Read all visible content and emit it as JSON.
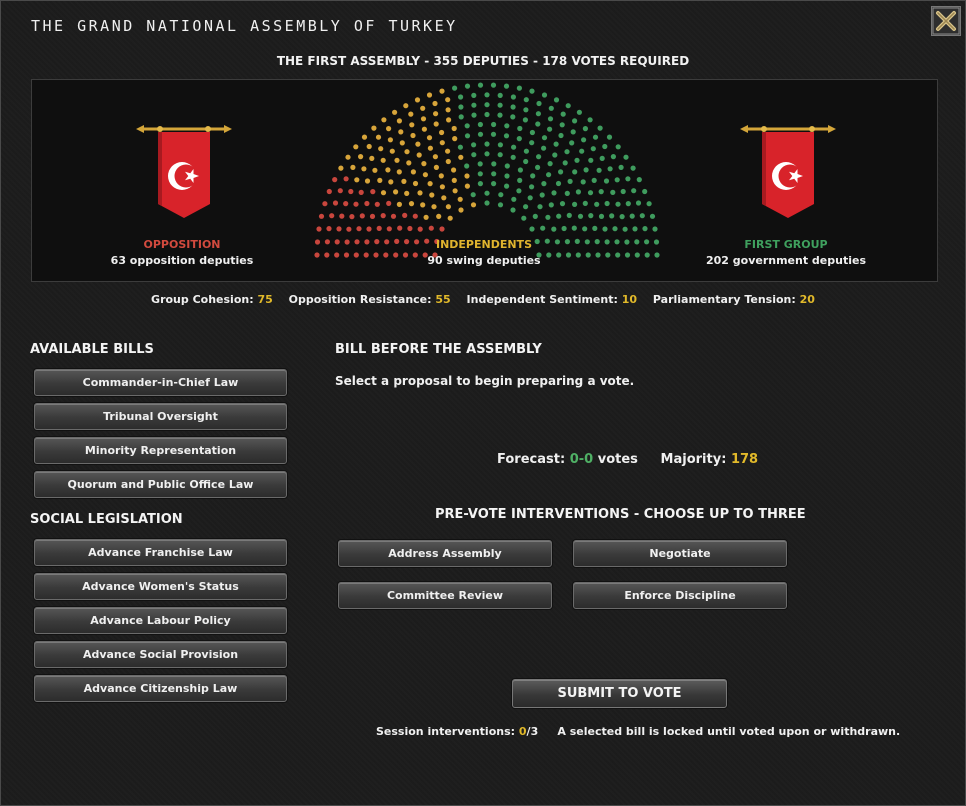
{
  "title": "THE GRAND NATIONAL ASSEMBLY OF TURKEY",
  "subtitle": "THE FIRST ASSEMBLY - 355 DEPUTIES - 178 VOTES REQUIRED",
  "colors": {
    "opposition": "#c9463d",
    "independents": "#d8a53a",
    "government": "#3f9c5e",
    "value": "#e1b92a",
    "banner": "#d8232a"
  },
  "factions": {
    "opposition": {
      "label": "OPPOSITION",
      "desc": "63 opposition deputies",
      "seats": 63
    },
    "independents": {
      "label": "INDEPENDENTS",
      "desc": "90 swing deputies",
      "seats": 90
    },
    "government": {
      "label": "FIRST GROUP",
      "desc": "202 government deputies",
      "seats": 202
    }
  },
  "stats": [
    {
      "label": "Group Cohesion:",
      "value": "75"
    },
    {
      "label": "Opposition Resistance:",
      "value": "55"
    },
    {
      "label": "Independent Sentiment:",
      "value": "10"
    },
    {
      "label": "Parliamentary Tension:",
      "value": "20"
    }
  ],
  "available_bills": {
    "heading": "AVAILABLE BILLS",
    "items": [
      "Commander-in-Chief Law",
      "Tribunal Oversight",
      "Minority Representation",
      "Quorum and Public Office Law"
    ]
  },
  "social_legislation": {
    "heading": "SOCIAL LEGISLATION",
    "items": [
      "Advance Franchise Law",
      "Advance Women's Status",
      "Advance Labour Policy",
      "Advance Social Provision",
      "Advance Citizenship Law"
    ]
  },
  "bill": {
    "heading": "BILL BEFORE THE ASSEMBLY",
    "prompt": "Select a proposal to begin preparing a vote.",
    "forecast_label": "Forecast:",
    "forecast_for": "0",
    "forecast_dash": "-",
    "forecast_against": "0",
    "forecast_unit": "votes",
    "majority_label": "Majority:",
    "majority_value": "178"
  },
  "interventions": {
    "heading": "PRE-VOTE INTERVENTIONS - CHOOSE UP TO THREE",
    "items": [
      "Address Assembly",
      "Negotiate",
      "Committee Review",
      "Enforce Discipline"
    ]
  },
  "submit_label": "SUBMIT TO VOTE",
  "footer": {
    "session_label": "Session interventions:",
    "used": "0",
    "total": "/3",
    "note": "A selected bill is locked until voted upon or withdrawn."
  }
}
